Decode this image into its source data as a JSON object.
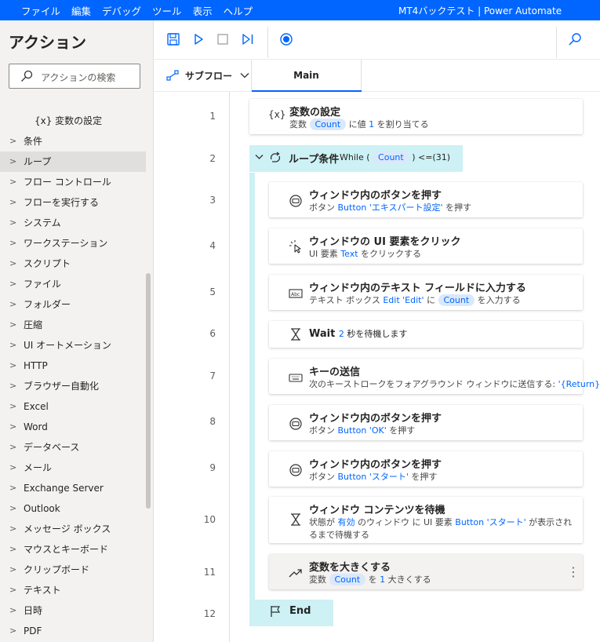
{
  "menu": [
    "ファイル",
    "編集",
    "デバッグ",
    "ツール",
    "表示",
    "ヘルプ"
  ],
  "app_title": "MT4バックテスト | Power Automate",
  "actions_panel": {
    "title": "アクション",
    "search_placeholder": "アクションの検索",
    "var_item": "{x} 変数の設定",
    "categories": [
      "条件",
      "ループ",
      "フロー コントロール",
      "フローを実行する",
      "システム",
      "ワークステーション",
      "スクリプト",
      "ファイル",
      "フォルダー",
      "圧縮",
      "UI オートメーション",
      "HTTP",
      "ブラウザー自動化",
      "Excel",
      "Word",
      "データベース",
      "メール",
      "Exchange Server",
      "Outlook",
      "メッセージ ボックス",
      "マウスとキーボード",
      "クリップボード",
      "テキスト",
      "日時",
      "PDF"
    ],
    "selected": "ループ"
  },
  "toolbar": {
    "icons": [
      "save-icon",
      "run-icon",
      "stop-icon",
      "step-icon",
      "record-icon",
      "search-icon"
    ]
  },
  "tabs": {
    "subflow": "サブフロー",
    "main": "Main"
  },
  "line_numbers": [
    "1",
    "2",
    "3",
    "4",
    "5",
    "6",
    "7",
    "8",
    "9",
    "10",
    "11",
    "12"
  ],
  "steps": {
    "s1": {
      "icon": "{x}",
      "title": "変数の設定",
      "a": "変数 ",
      "var": "Count",
      "b": " に値 ",
      "num": "1",
      "c": " を割り当てる"
    },
    "s2": {
      "title": "ループ条件",
      "while": "While (",
      "var": "Count",
      "cond": ") <=(31)"
    },
    "s3": {
      "title": "ウィンドウ内のボタンを押す",
      "a": "ボタン ",
      "target": "Button 'エキスパート設定'",
      "b": " を押す"
    },
    "s4": {
      "title": "ウィンドウの UI 要素をクリック",
      "a": "UI 要素 ",
      "target": "Text",
      "b": " をクリックする"
    },
    "s5": {
      "title": "ウィンドウ内のテキスト フィールドに入力する",
      "a": "テキスト ボックス ",
      "target": "Edit 'Edit'",
      "b": " に ",
      "var": "Count",
      "c": " を入力する"
    },
    "s6": {
      "title": "Wait",
      "num": "2",
      "b": " 秒を待機します"
    },
    "s7": {
      "title": "キーの送信",
      "a": "次のキーストロークをフォアグラウンド ウィンドウに送信する: ",
      "target": "'{Return}'"
    },
    "s8": {
      "title": "ウィンドウ内のボタンを押す",
      "a": "ボタン ",
      "target": "Button 'OK'",
      "b": " を押す"
    },
    "s9": {
      "title": "ウィンドウ内のボタンを押す",
      "a": "ボタン ",
      "target": "Button 'スタート'",
      "b": " を押す"
    },
    "s10": {
      "title": "ウィンドウ コンテンツを待機",
      "a": "状態が ",
      "state": "有効",
      "b": " のウィンドウ に UI 要素 ",
      "target": "Button 'スタート'",
      "c": " が表示され",
      "line2": "るまで待機する"
    },
    "s11": {
      "title": "変数を大きくする",
      "a": "変数 ",
      "var": "Count",
      "b": " を ",
      "num": "1",
      "c": " 大きくする"
    },
    "s12": {
      "title": "End"
    }
  },
  "colors": {
    "accent": "#0066ff",
    "loop": "#cdf1f5",
    "pill_bg": "#dbe8fb"
  }
}
